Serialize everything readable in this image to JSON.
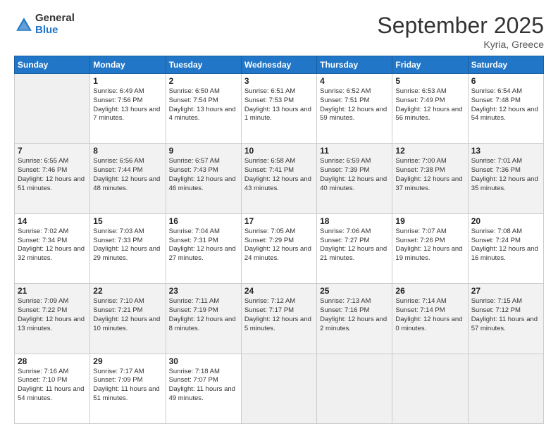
{
  "header": {
    "logo_general": "General",
    "logo_blue": "Blue",
    "month_title": "September 2025",
    "location": "Kyria, Greece"
  },
  "days_of_week": [
    "Sunday",
    "Monday",
    "Tuesday",
    "Wednesday",
    "Thursday",
    "Friday",
    "Saturday"
  ],
  "weeks": [
    [
      {
        "day": "",
        "sunrise": "",
        "sunset": "",
        "daylight": ""
      },
      {
        "day": "1",
        "sunrise": "Sunrise: 6:49 AM",
        "sunset": "Sunset: 7:56 PM",
        "daylight": "Daylight: 13 hours and 7 minutes."
      },
      {
        "day": "2",
        "sunrise": "Sunrise: 6:50 AM",
        "sunset": "Sunset: 7:54 PM",
        "daylight": "Daylight: 13 hours and 4 minutes."
      },
      {
        "day": "3",
        "sunrise": "Sunrise: 6:51 AM",
        "sunset": "Sunset: 7:53 PM",
        "daylight": "Daylight: 13 hours and 1 minute."
      },
      {
        "day": "4",
        "sunrise": "Sunrise: 6:52 AM",
        "sunset": "Sunset: 7:51 PM",
        "daylight": "Daylight: 12 hours and 59 minutes."
      },
      {
        "day": "5",
        "sunrise": "Sunrise: 6:53 AM",
        "sunset": "Sunset: 7:49 PM",
        "daylight": "Daylight: 12 hours and 56 minutes."
      },
      {
        "day": "6",
        "sunrise": "Sunrise: 6:54 AM",
        "sunset": "Sunset: 7:48 PM",
        "daylight": "Daylight: 12 hours and 54 minutes."
      }
    ],
    [
      {
        "day": "7",
        "sunrise": "Sunrise: 6:55 AM",
        "sunset": "Sunset: 7:46 PM",
        "daylight": "Daylight: 12 hours and 51 minutes."
      },
      {
        "day": "8",
        "sunrise": "Sunrise: 6:56 AM",
        "sunset": "Sunset: 7:44 PM",
        "daylight": "Daylight: 12 hours and 48 minutes."
      },
      {
        "day": "9",
        "sunrise": "Sunrise: 6:57 AM",
        "sunset": "Sunset: 7:43 PM",
        "daylight": "Daylight: 12 hours and 46 minutes."
      },
      {
        "day": "10",
        "sunrise": "Sunrise: 6:58 AM",
        "sunset": "Sunset: 7:41 PM",
        "daylight": "Daylight: 12 hours and 43 minutes."
      },
      {
        "day": "11",
        "sunrise": "Sunrise: 6:59 AM",
        "sunset": "Sunset: 7:39 PM",
        "daylight": "Daylight: 12 hours and 40 minutes."
      },
      {
        "day": "12",
        "sunrise": "Sunrise: 7:00 AM",
        "sunset": "Sunset: 7:38 PM",
        "daylight": "Daylight: 12 hours and 37 minutes."
      },
      {
        "day": "13",
        "sunrise": "Sunrise: 7:01 AM",
        "sunset": "Sunset: 7:36 PM",
        "daylight": "Daylight: 12 hours and 35 minutes."
      }
    ],
    [
      {
        "day": "14",
        "sunrise": "Sunrise: 7:02 AM",
        "sunset": "Sunset: 7:34 PM",
        "daylight": "Daylight: 12 hours and 32 minutes."
      },
      {
        "day": "15",
        "sunrise": "Sunrise: 7:03 AM",
        "sunset": "Sunset: 7:33 PM",
        "daylight": "Daylight: 12 hours and 29 minutes."
      },
      {
        "day": "16",
        "sunrise": "Sunrise: 7:04 AM",
        "sunset": "Sunset: 7:31 PM",
        "daylight": "Daylight: 12 hours and 27 minutes."
      },
      {
        "day": "17",
        "sunrise": "Sunrise: 7:05 AM",
        "sunset": "Sunset: 7:29 PM",
        "daylight": "Daylight: 12 hours and 24 minutes."
      },
      {
        "day": "18",
        "sunrise": "Sunrise: 7:06 AM",
        "sunset": "Sunset: 7:27 PM",
        "daylight": "Daylight: 12 hours and 21 minutes."
      },
      {
        "day": "19",
        "sunrise": "Sunrise: 7:07 AM",
        "sunset": "Sunset: 7:26 PM",
        "daylight": "Daylight: 12 hours and 19 minutes."
      },
      {
        "day": "20",
        "sunrise": "Sunrise: 7:08 AM",
        "sunset": "Sunset: 7:24 PM",
        "daylight": "Daylight: 12 hours and 16 minutes."
      }
    ],
    [
      {
        "day": "21",
        "sunrise": "Sunrise: 7:09 AM",
        "sunset": "Sunset: 7:22 PM",
        "daylight": "Daylight: 12 hours and 13 minutes."
      },
      {
        "day": "22",
        "sunrise": "Sunrise: 7:10 AM",
        "sunset": "Sunset: 7:21 PM",
        "daylight": "Daylight: 12 hours and 10 minutes."
      },
      {
        "day": "23",
        "sunrise": "Sunrise: 7:11 AM",
        "sunset": "Sunset: 7:19 PM",
        "daylight": "Daylight: 12 hours and 8 minutes."
      },
      {
        "day": "24",
        "sunrise": "Sunrise: 7:12 AM",
        "sunset": "Sunset: 7:17 PM",
        "daylight": "Daylight: 12 hours and 5 minutes."
      },
      {
        "day": "25",
        "sunrise": "Sunrise: 7:13 AM",
        "sunset": "Sunset: 7:16 PM",
        "daylight": "Daylight: 12 hours and 2 minutes."
      },
      {
        "day": "26",
        "sunrise": "Sunrise: 7:14 AM",
        "sunset": "Sunset: 7:14 PM",
        "daylight": "Daylight: 12 hours and 0 minutes."
      },
      {
        "day": "27",
        "sunrise": "Sunrise: 7:15 AM",
        "sunset": "Sunset: 7:12 PM",
        "daylight": "Daylight: 11 hours and 57 minutes."
      }
    ],
    [
      {
        "day": "28",
        "sunrise": "Sunrise: 7:16 AM",
        "sunset": "Sunset: 7:10 PM",
        "daylight": "Daylight: 11 hours and 54 minutes."
      },
      {
        "day": "29",
        "sunrise": "Sunrise: 7:17 AM",
        "sunset": "Sunset: 7:09 PM",
        "daylight": "Daylight: 11 hours and 51 minutes."
      },
      {
        "day": "30",
        "sunrise": "Sunrise: 7:18 AM",
        "sunset": "Sunset: 7:07 PM",
        "daylight": "Daylight: 11 hours and 49 minutes."
      },
      {
        "day": "",
        "sunrise": "",
        "sunset": "",
        "daylight": ""
      },
      {
        "day": "",
        "sunrise": "",
        "sunset": "",
        "daylight": ""
      },
      {
        "day": "",
        "sunrise": "",
        "sunset": "",
        "daylight": ""
      },
      {
        "day": "",
        "sunrise": "",
        "sunset": "",
        "daylight": ""
      }
    ]
  ]
}
